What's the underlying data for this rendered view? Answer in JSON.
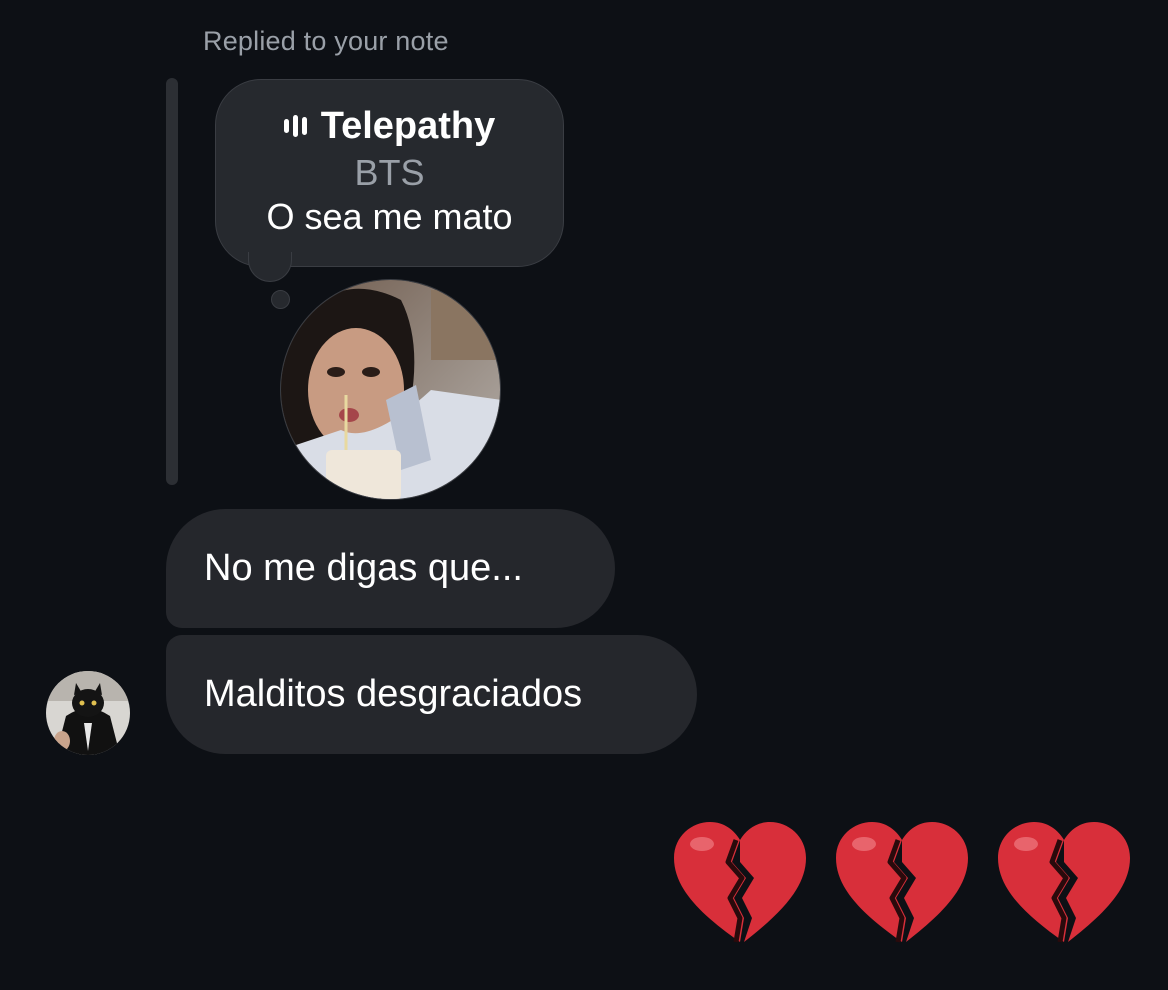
{
  "reply_label": "Replied to your note",
  "note": {
    "icon": "music-bars-icon",
    "song": "Telepathy",
    "artist": "BTS",
    "text": "O sea me mato"
  },
  "messages": [
    {
      "text": "No me digas que..."
    },
    {
      "text": "Malditos desgraciados"
    }
  ],
  "reaction": {
    "emoji": "broken-heart-icon",
    "count": 3,
    "color": "#d82f3a"
  },
  "colors": {
    "background": "#0d1015",
    "bubble": "#25272c",
    "secondary_text": "#9aa0a8",
    "primary_text": "#ffffff"
  }
}
